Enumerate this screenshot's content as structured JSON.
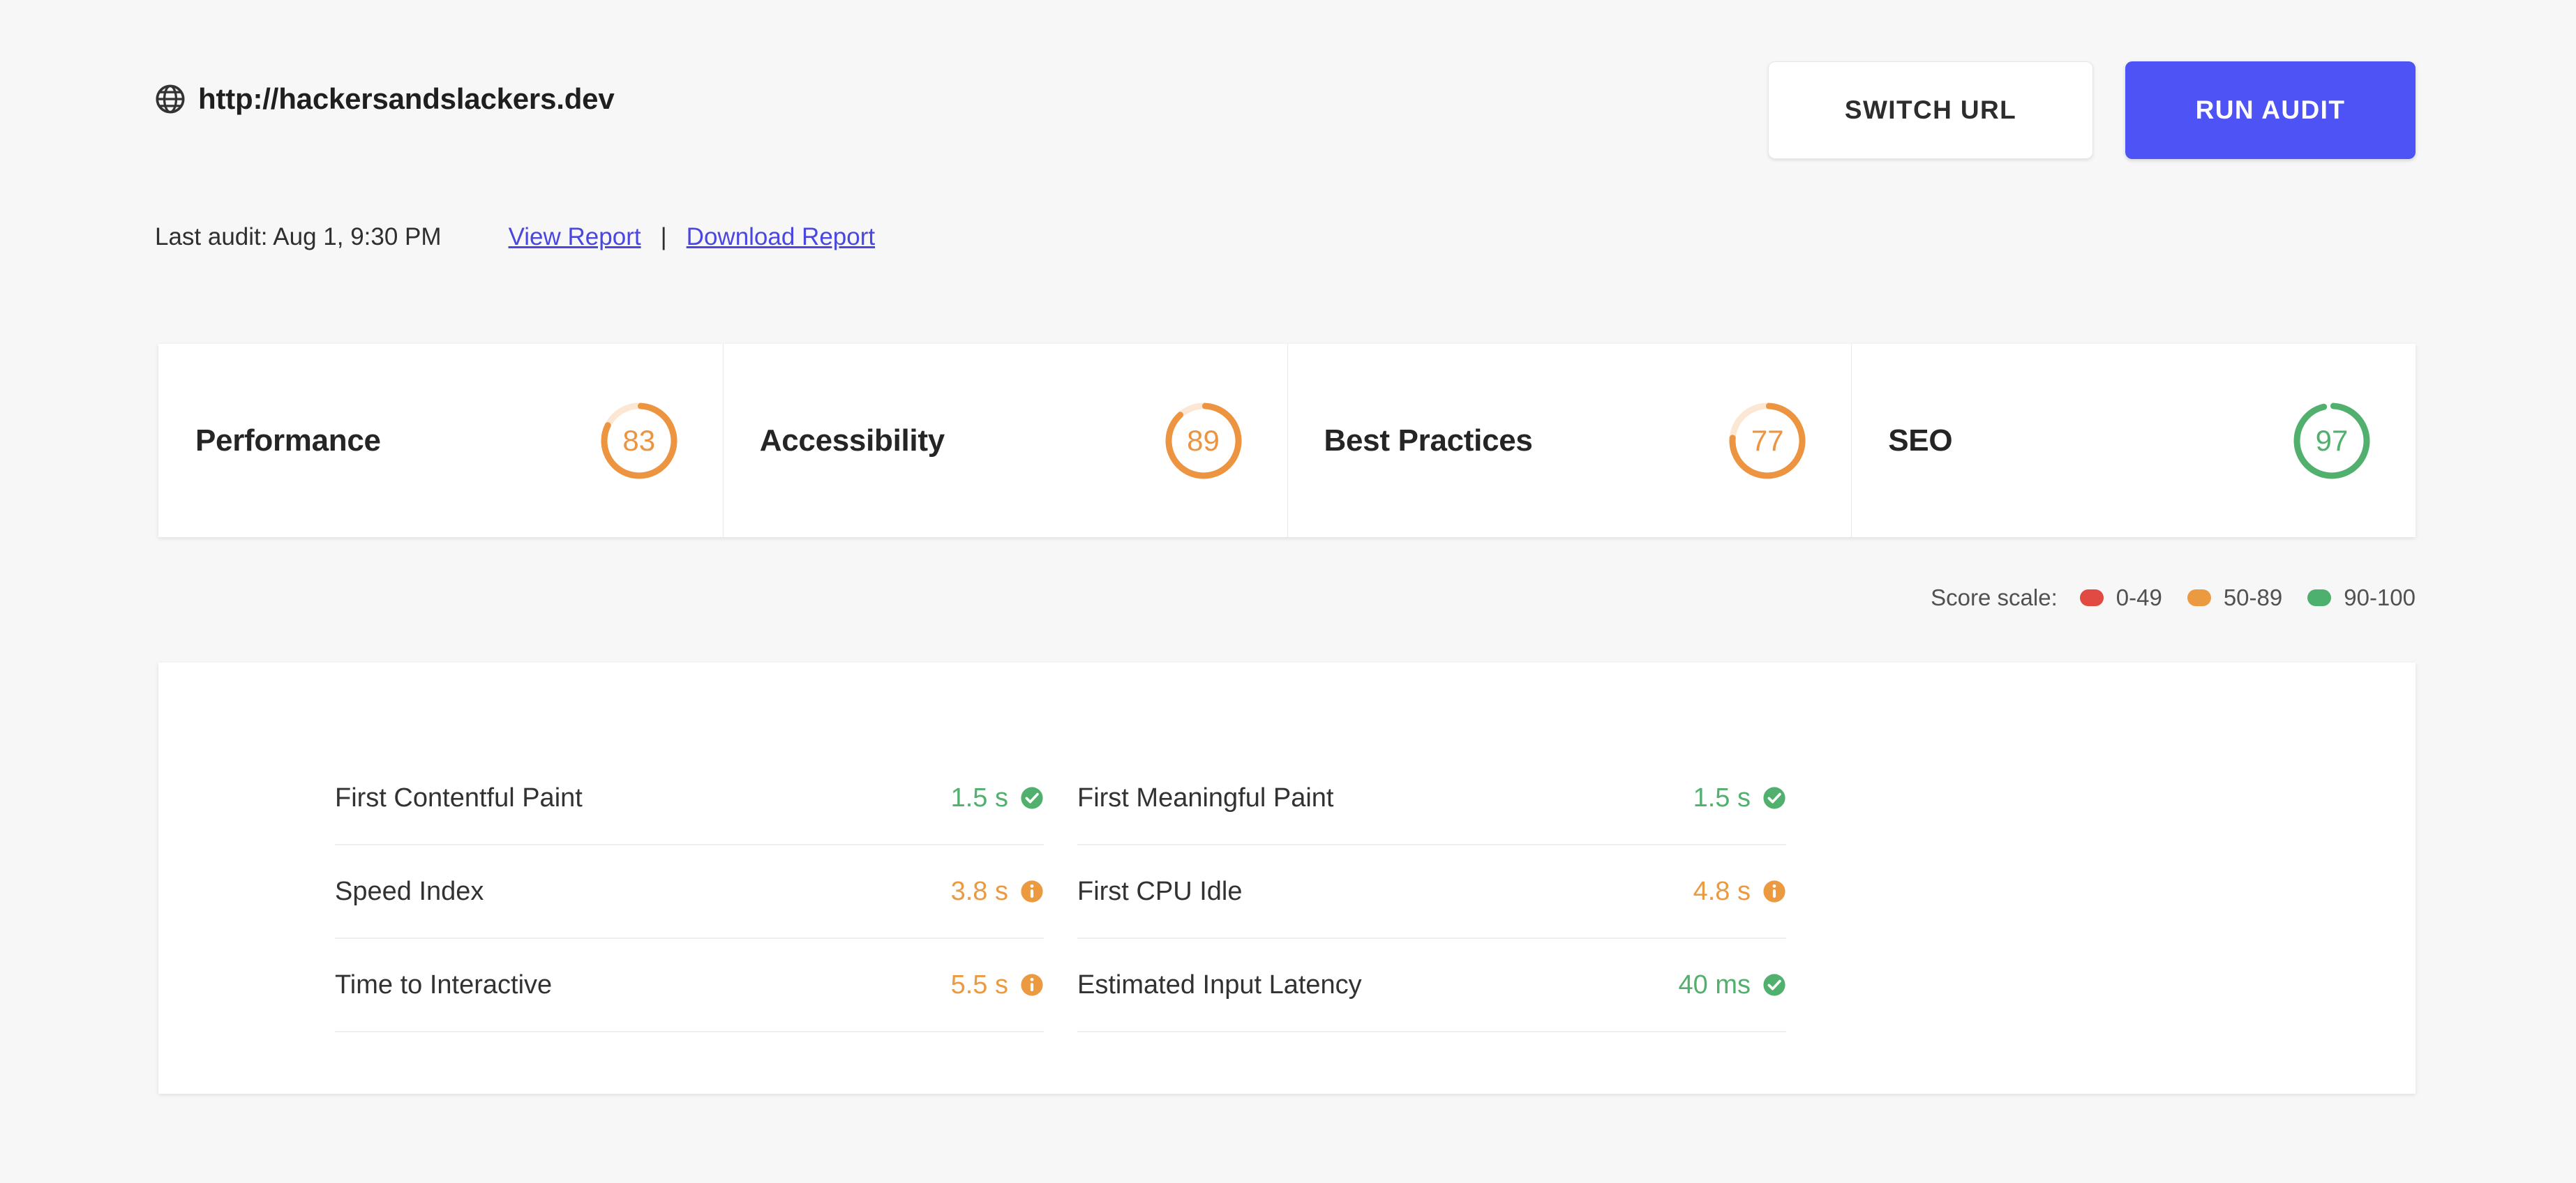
{
  "header": {
    "globe_icon": "globe-icon",
    "url": "http://hackersandslackers.dev",
    "switch_url_label": "SWITCH URL",
    "run_audit_label": "RUN AUDIT",
    "run_audit_color": "#4d53f5"
  },
  "audit_meta": {
    "last_audit": "Last audit: Aug 1, 9:30 PM",
    "view_report_label": "View Report ",
    "separator": "|",
    "download_report_label": "Download Report",
    "link_color": "#4a46e0"
  },
  "scores": [
    {
      "label": "Performance",
      "value": 83,
      "display": "83",
      "color": "#ed9440",
      "track": "#fbe7d4"
    },
    {
      "label": "Accessibility",
      "value": 89,
      "display": "89",
      "color": "#ed9440",
      "track": "#fbe7d4"
    },
    {
      "label": "Best Practices",
      "value": 77,
      "display": "77",
      "color": "#ed9440",
      "track": "#fbe7d4"
    },
    {
      "label": "SEO",
      "value": 97,
      "display": "97",
      "color": "#52b06e",
      "track": "#ffffff"
    }
  ],
  "legend": {
    "title": "Score scale:",
    "items": [
      {
        "label": "0-49",
        "color": "#e04a43"
      },
      {
        "label": "50-89",
        "color": "#eb9a40"
      },
      {
        "label": "90-100",
        "color": "#4eb06e"
      }
    ]
  },
  "metrics": {
    "left": [
      {
        "name": "First Contentful Paint",
        "value": "1.5 s",
        "status": "good",
        "icon": "check-circle-icon",
        "color": "#52b06e"
      },
      {
        "name": "Speed Index",
        "value": "3.8 s",
        "status": "warn",
        "icon": "info-circle-icon",
        "color": "#eb9a40"
      },
      {
        "name": "Time to Interactive",
        "value": "5.5 s",
        "status": "warn",
        "icon": "info-circle-icon",
        "color": "#eb9a40"
      }
    ],
    "right": [
      {
        "name": "First Meaningful Paint",
        "value": "1.5 s",
        "status": "good",
        "icon": "check-circle-icon",
        "color": "#52b06e"
      },
      {
        "name": "First CPU Idle",
        "value": "4.8 s",
        "status": "warn",
        "icon": "info-circle-icon",
        "color": "#eb9a40"
      },
      {
        "name": "Estimated Input Latency",
        "value": "40 ms",
        "status": "good",
        "icon": "check-circle-icon",
        "color": "#52b06e"
      }
    ]
  }
}
